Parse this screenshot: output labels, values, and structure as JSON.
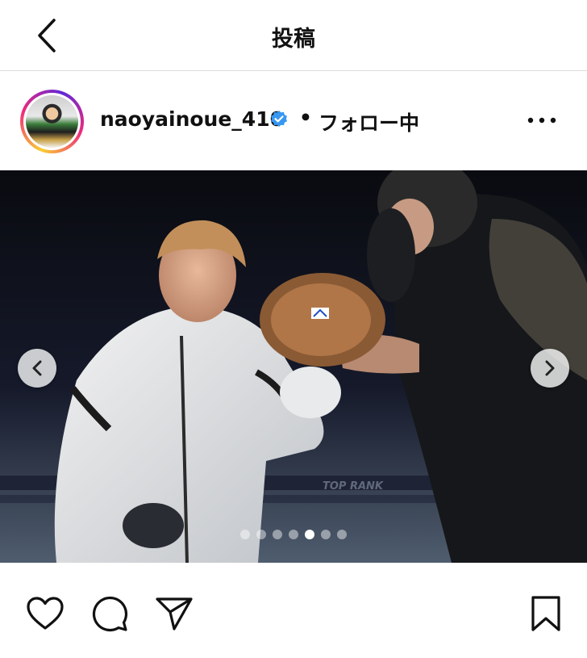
{
  "header": {
    "title": "投稿"
  },
  "post": {
    "username": "naoyainoue_410",
    "separator": "•",
    "follow_status": "フォロー中",
    "carousel": {
      "total": 7,
      "active_index": 4
    }
  },
  "icons": {
    "back": "chevron-left-icon",
    "verified": "verified-badge-icon",
    "more": "more-horizontal-icon",
    "prev": "chevron-left-icon",
    "next": "chevron-right-icon",
    "like": "heart-icon",
    "comment": "comment-icon",
    "share": "send-icon",
    "save": "bookmark-icon"
  },
  "colors": {
    "verified": "#3897f0",
    "text": "#111111",
    "divider": "#dbdbdb"
  }
}
